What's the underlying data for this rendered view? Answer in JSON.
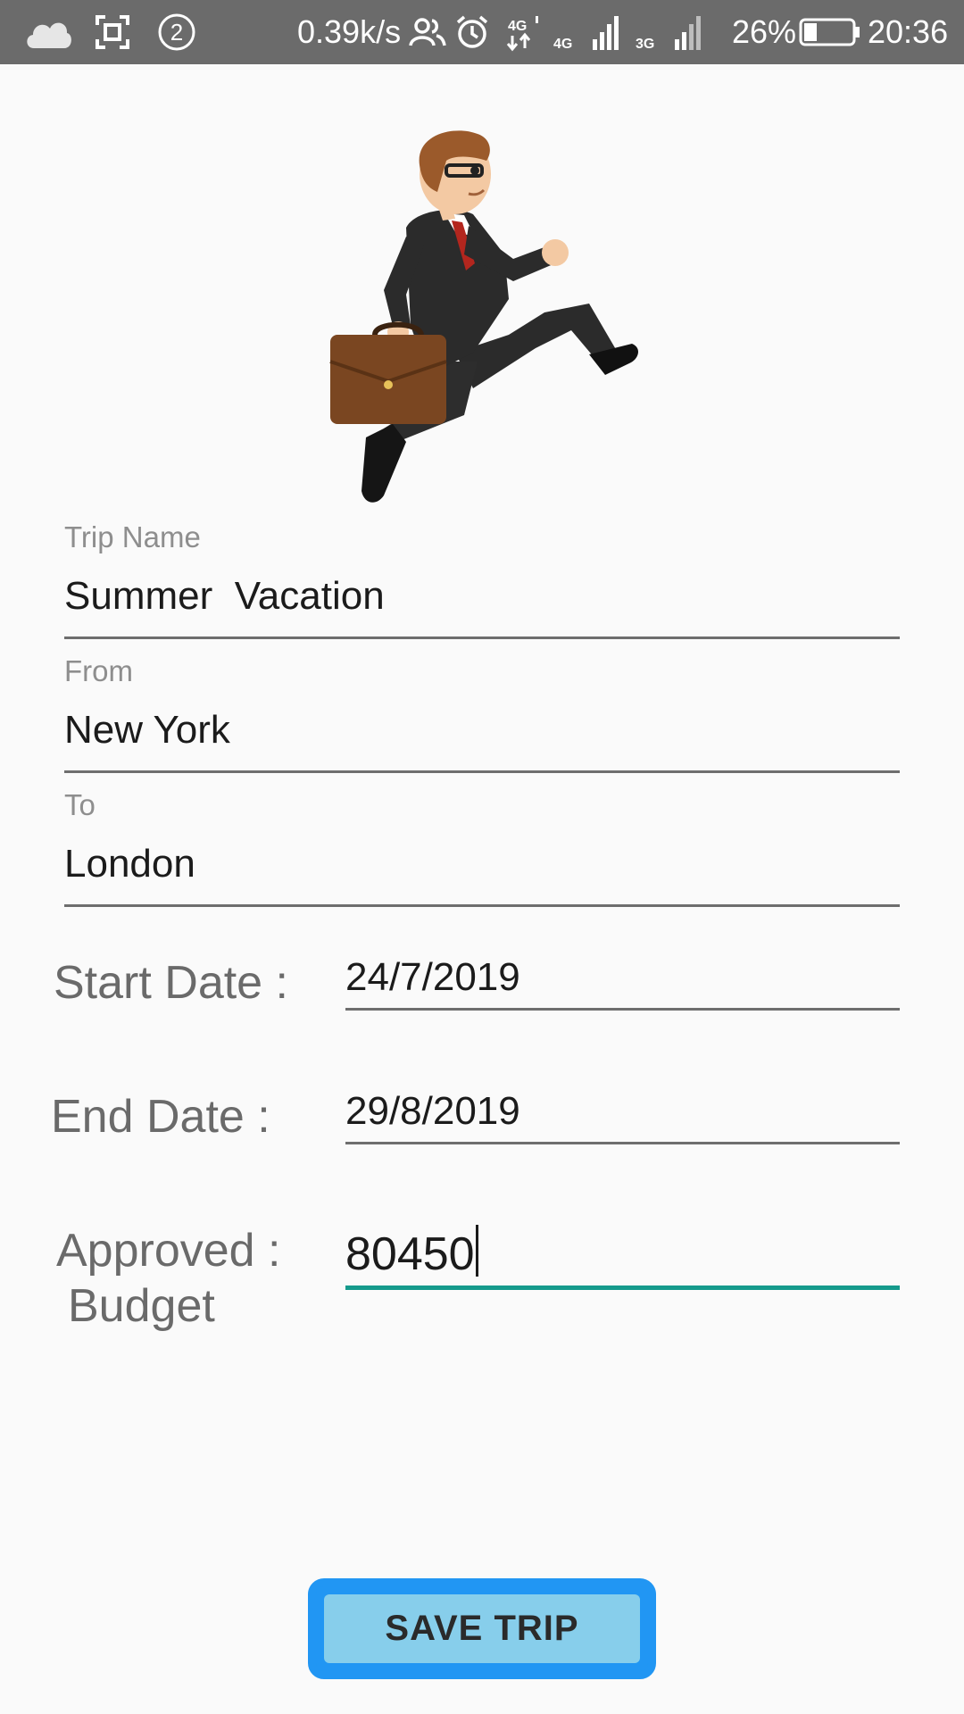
{
  "status_bar": {
    "network_speed": "0.39k/s",
    "notification_count": "2",
    "network_4g": "4G",
    "network_3g": "3G",
    "battery_percent": "26%",
    "battery_level": 0.26,
    "time": "20:36",
    "icons": [
      "cloud-icon",
      "screenshot-icon",
      "notification-count-icon",
      "contacts-icon",
      "alarm-icon",
      "data-transfer-icon",
      "signal-icon",
      "battery-icon"
    ]
  },
  "form": {
    "trip_name": {
      "label": "Trip Name",
      "value": "Summer  Vacation"
    },
    "from": {
      "label": "From",
      "value": "New York"
    },
    "to": {
      "label": "To",
      "value": "London"
    },
    "start_date": {
      "label": "Start Date :",
      "value": "24/7/2019"
    },
    "end_date": {
      "label": "End Date :",
      "value": "29/8/2019"
    },
    "approved_budget": {
      "label_line1": "Approved :",
      "label_line2": "Budget",
      "value": "80450"
    }
  },
  "actions": {
    "save_label": "SAVE TRIP"
  },
  "colors": {
    "status_bar_bg": "#6b6b6b",
    "accent_focus": "#159a8c",
    "button_fill": "#87ceeb",
    "button_border": "#2196f3"
  }
}
